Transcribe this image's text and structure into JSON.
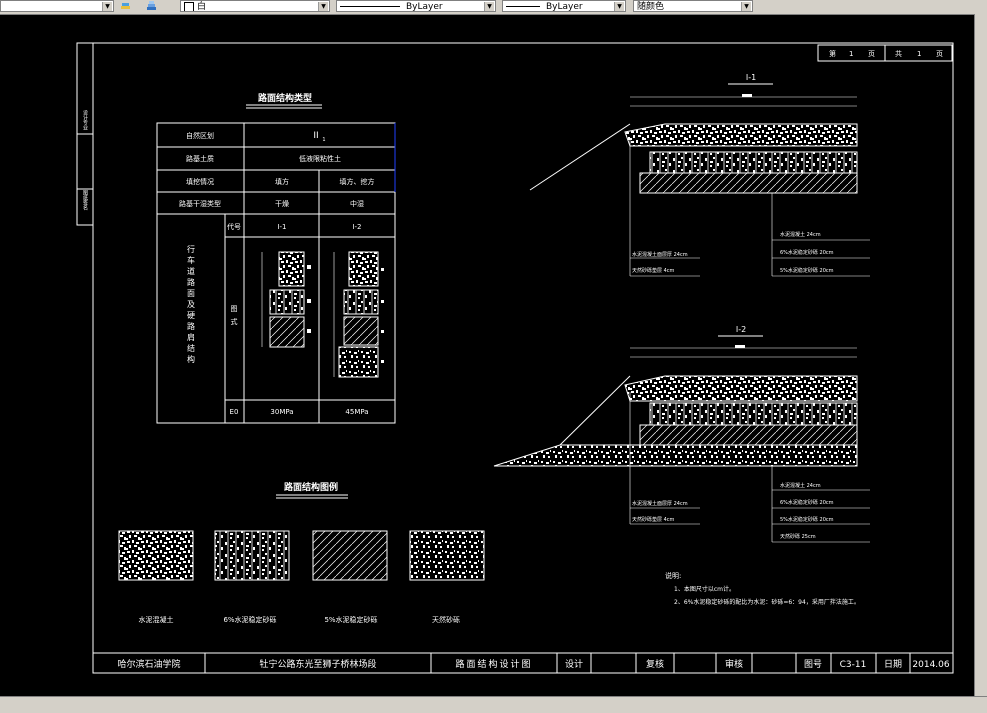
{
  "toolbar": {
    "layer_value": "白",
    "linetype_value": "ByLayer",
    "lineweight_value": "ByLayer",
    "color_value": "随颜色"
  },
  "drawing": {
    "page_label": "第",
    "page_num": "1",
    "page_unit": "页",
    "total_label": "共",
    "total_num": "1",
    "total_unit": "页",
    "table_title": "路面结构类型",
    "row_natural_zone": "自然区划",
    "natural_zone_value": "II",
    "natural_zone_sub": "1",
    "row_soil": "路基土质",
    "soil_value": "低液限粘性土",
    "row_fill": "填挖情况",
    "fill_a": "填方",
    "fill_b": "填方、挖方",
    "row_moisture": "路基干湿类型",
    "moist_a": "干燥",
    "moist_b": "中湿",
    "vertical_label": "行车道路面及硬路肩结构",
    "col_code": "代号",
    "code_a": "I-1",
    "code_b": "I-2",
    "col_figure": "图式",
    "col_e0": "E0",
    "e0_a": "30MPa",
    "e0_b": "45MPa",
    "legend_title": "路面结构图例",
    "legend_items": [
      "水泥混凝土",
      "6%水泥稳定砂砾",
      "5%水泥稳定砂砾",
      "天然砂砾"
    ],
    "section1_title": "I-1",
    "section2_title": "I-2",
    "layers_left_1": [
      "水泥混凝土面层厚 24cm",
      "天然砂砾垫层 4cm"
    ],
    "layers_right_1": [
      "水泥混凝土 24cm",
      "6%水泥稳定砂砾 20cm",
      "5%水泥稳定砂砾 20cm"
    ],
    "layers_left_2": [
      "水泥混凝土面层厚 24cm",
      "天然砂砾垫层 4cm"
    ],
    "layers_right_2": [
      "水泥混凝土 24cm",
      "6%水泥稳定砂砾 20cm",
      "5%水泥稳定砂砾 20cm",
      "天然砂砾 25cm"
    ],
    "notes_title": "说明:",
    "note_1": "1、本图尺寸以cm计。",
    "note_2": "2、6%水泥稳定砂砾的配比为水泥：砂砾=6：94，采用厂拌法施工。",
    "side_label_1": "设计专业",
    "side_label_2": "图纸签名"
  },
  "title_block": {
    "school": "哈尔滨石油学院",
    "project": "牡宁公路东光至狮子桥林场段",
    "drawing_name": "路面结构设计图",
    "design": "设计",
    "review": "复核",
    "approve": "审核",
    "drawing_no_label": "图号",
    "drawing_no": "C3-11",
    "date_label": "日期",
    "date": "2014.06"
  }
}
